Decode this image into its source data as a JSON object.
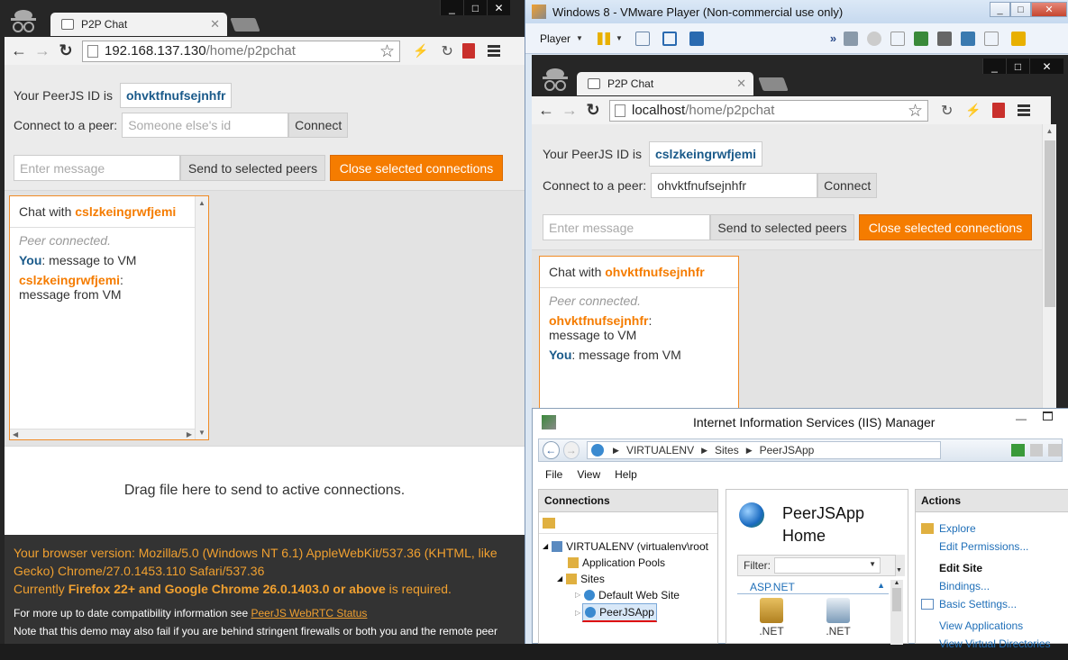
{
  "left_browser": {
    "tab_title": "P2P Chat",
    "url_host": "192.168.137.130",
    "url_path": "/home/p2pchat",
    "peer_id_label": "Your PeerJS ID is",
    "peer_id": "ohvktfnufsejnhfr",
    "connect_label": "Connect to a peer:",
    "connect_placeholder": "Someone else's id",
    "connect_button": "Connect",
    "message_placeholder": "Enter message",
    "send_button": "Send to selected peers",
    "close_button": "Close selected connections",
    "chat_with_label": "Chat with",
    "chat_peer": "cslzkeingrwfjemi",
    "messages": {
      "system": "Peer connected.",
      "m1_sender": "You",
      "m1_text": ": message to VM",
      "m2_sender": "cslzkeingrwfjemi",
      "m2_text": "message from VM"
    },
    "dropzone": "Drag file here to send to active connections.",
    "footer": {
      "line1": "Your browser version: Mozilla/5.0 (Windows NT 6.1) AppleWebKit/537.36 (KHTML, like Gecko) Chrome/27.0.1453.110 Safari/537.36",
      "line2_pre": "Currently",
      "line2_bold": "Firefox 22+ and Google Chrome 26.0.1403.0 or above",
      "line2_post": "is required.",
      "info_pre": "For more up to date compatibility information see",
      "info_link": "PeerJS WebRTC Status",
      "note": "Note that this demo may also fail if you are behind stringent firewalls or both you and the remote peer"
    }
  },
  "vm_window": {
    "title": "Windows 8 - VMware Player (Non-commercial use only)",
    "player_menu": "Player",
    "browser": {
      "tab_title": "P2P Chat",
      "url_host": "localhost",
      "url_path": "/home/p2pchat",
      "peer_id_label": "Your PeerJS ID is",
      "peer_id": "cslzkeingrwfjemi",
      "connect_label": "Connect to a peer:",
      "connect_value": "ohvktfnufsejnhfr",
      "connect_button": "Connect",
      "message_placeholder": "Enter message",
      "send_button": "Send to selected peers",
      "close_button": "Close selected connections",
      "chat_with_label": "Chat with",
      "chat_peer": "ohvktfnufsejnhfr",
      "messages": {
        "system": "Peer connected.",
        "m1_sender": "ohvktfnufsejnhfr",
        "m1_text": "message to VM",
        "m2_sender": "You",
        "m2_text": ": message from VM"
      }
    },
    "iis": {
      "title": "Internet Information Services (IIS) Manager",
      "breadcrumb": [
        "VIRTUALENV",
        "Sites",
        "PeerJSApp"
      ],
      "menu": [
        "File",
        "View",
        "Help"
      ],
      "connections_header": "Connections",
      "tree": {
        "root": "VIRTUALENV (virtualenv\\root",
        "app_pools": "Application Pools",
        "sites": "Sites",
        "default_site": "Default Web Site",
        "peerjsapp": "PeerJSApp"
      },
      "home_title_1": "PeerJSApp",
      "home_title_2": "Home",
      "filter_label": "Filter:",
      "group_label": "ASP.NET",
      "feature_1": ".NET",
      "feature_2": ".NET",
      "actions_header": "Actions",
      "actions": {
        "explore": "Explore",
        "edit_permissions": "Edit Permissions...",
        "edit_site": "Edit Site",
        "bindings": "Bindings...",
        "basic_settings": "Basic Settings...",
        "view_apps": "View Applications",
        "view_vdirs": "View Virtual Directories"
      }
    }
  }
}
